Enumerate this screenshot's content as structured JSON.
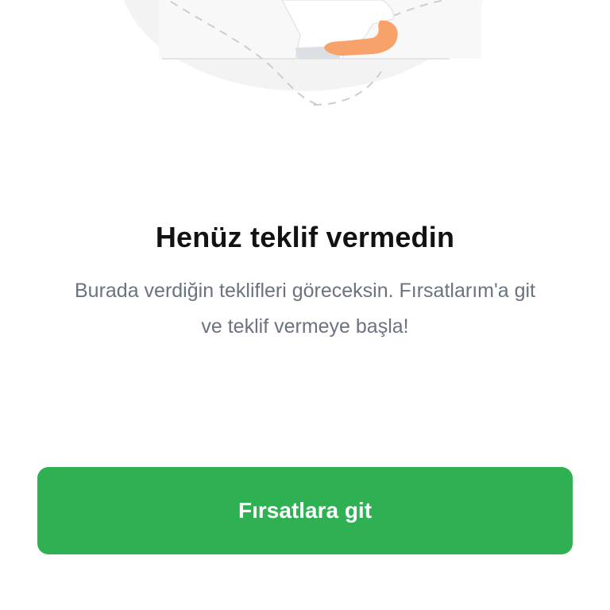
{
  "empty_state": {
    "illustration_icon": "person-with-laptop-illustration",
    "title": "Henüz teklif vermedin",
    "description_line1": "Burada verdiğin teklifleri göreceksin. Fırsatlarım'a git",
    "description_line2": "ve teklif vermeye başla!"
  },
  "cta": {
    "label": "Fırsatlara git"
  },
  "colors": {
    "primary_green": "#2fb153",
    "title_text": "#121212",
    "body_text": "#6b7280",
    "illustration_bg": "#f3f3f3",
    "skin": "#f7a26b"
  }
}
